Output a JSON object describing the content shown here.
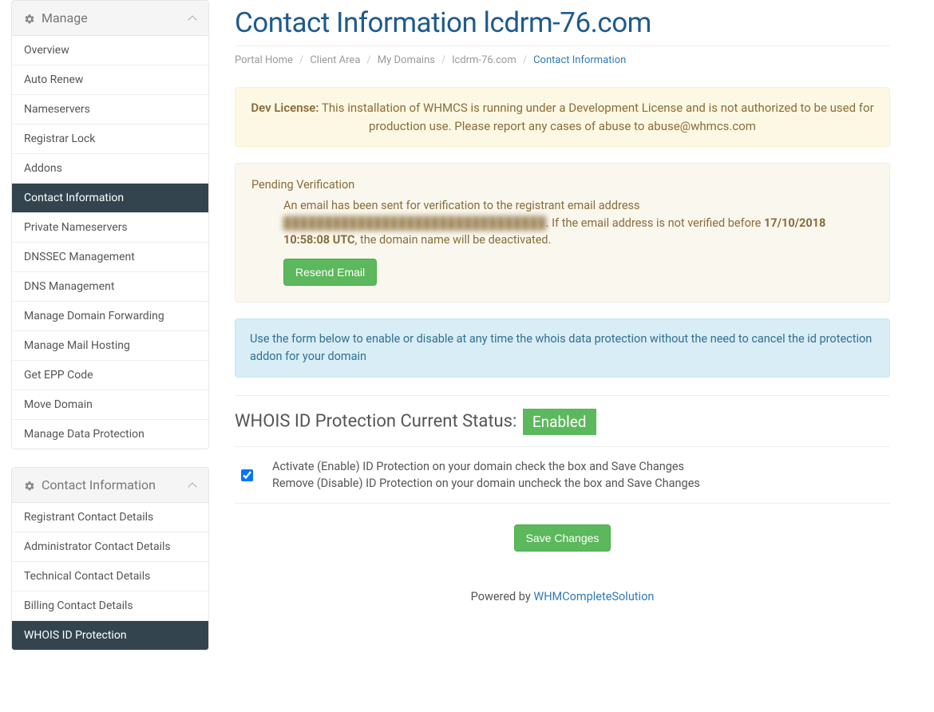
{
  "sidebar": {
    "manage": {
      "title": "Manage",
      "items": [
        "Overview",
        "Auto Renew",
        "Nameservers",
        "Registrar Lock",
        "Addons",
        "Contact Information",
        "Private Nameservers",
        "DNSSEC Management",
        "DNS Management",
        "Manage Domain Forwarding",
        "Manage Mail Hosting",
        "Get EPP Code",
        "Move Domain",
        "Manage Data Protection"
      ],
      "active_index": 5
    },
    "contact_info": {
      "title": "Contact Information",
      "items": [
        "Registrant Contact Details",
        "Administrator Contact Details",
        "Technical Contact Details",
        "Billing Contact Details",
        "WHOIS ID Protection"
      ],
      "active_index": 4
    }
  },
  "page_title": "Contact Information lcdrm-76.com",
  "breadcrumb": {
    "items": [
      "Portal Home",
      "Client Area",
      "My Domains",
      "lcdrm-76.com"
    ],
    "current": "Contact Information"
  },
  "dev_license": {
    "label": "Dev License:",
    "text": "This installation of WHMCS is running under a Development License and is not authorized to be used for production use. Please report any cases of abuse to abuse@whmcs.com"
  },
  "pending": {
    "title": "Pending Verification",
    "pre_text": "An email has been sent for verification to the registrant email address ",
    "blurred_email": "████████████████████████████████",
    "post_text_1": ". If the email address is not verified before ",
    "deadline": "17/10/2018 10:58:08 UTC",
    "post_text_2": ", the domain name will be deactivated.",
    "button": "Resend Email"
  },
  "info_box": "Use the form below to enable or disable at any time the whois data protection without the need to cancel the id protection addon for your domain",
  "whois": {
    "heading": "WHOIS ID Protection Current Status:",
    "status": "Enabled",
    "line1": "Activate (Enable) ID Protection on your domain check the box and Save Changes",
    "line2": "Remove (Disable) ID Protection on your domain uncheck the box and Save Changes",
    "checked": true,
    "save_button": "Save Changes"
  },
  "footer": {
    "text": "Powered by ",
    "link": "WHMCompleteSolution"
  }
}
